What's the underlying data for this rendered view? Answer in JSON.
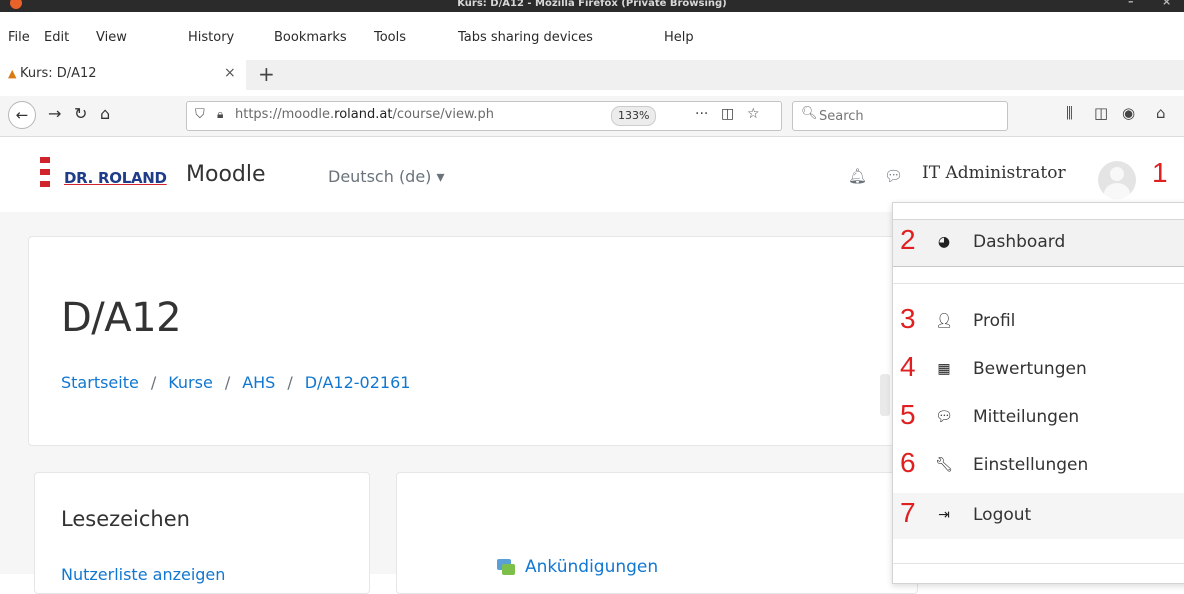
{
  "window": {
    "title": "Kurs: D/A12 - Mozilla Firefox (Private Browsing)"
  },
  "menubar": {
    "items": [
      "File",
      "Edit",
      "View",
      "History",
      "Bookmarks",
      "Tools",
      "Tabs sharing devices",
      "Help"
    ]
  },
  "tabs": [
    {
      "title": "Kurs: D/A12",
      "close": "×"
    }
  ],
  "newtab": "+",
  "navbar": {
    "url_prefix": "https://moodle.",
    "url_domain": "roland.at",
    "url_suffix": "/course/view.ph",
    "zoom": "133%",
    "more": "···",
    "search_placeholder": "Search"
  },
  "header": {
    "logo_brand": "DR. ROLAND",
    "site_name": "Moodle",
    "language": "Deutsch (de) ▾",
    "user_name": "IT Administrator"
  },
  "course": {
    "title": "D/A12",
    "breadcrumb": [
      "Startseite",
      "Kurse",
      "AHS",
      "D/A12-02161"
    ]
  },
  "sidebar": {
    "title": "Lesezeichen",
    "item": "Nutzerliste anzeigen"
  },
  "main": {
    "forum_link": "Ankündigungen"
  },
  "user_menu": {
    "items": [
      {
        "label": "Dashboard",
        "icon": "dashboard-icon",
        "number": "2"
      },
      {
        "label": "Profil",
        "icon": "user-icon",
        "number": "3"
      },
      {
        "label": "Bewertungen",
        "icon": "grades-table-icon",
        "number": "4"
      },
      {
        "label": "Mitteilungen",
        "icon": "chat-icon",
        "number": "5"
      },
      {
        "label": "Einstellungen",
        "icon": "wrench-icon",
        "number": "6"
      },
      {
        "label": "Logout",
        "icon": "sign-out-icon",
        "number": "7"
      }
    ],
    "avatar_number": "1"
  },
  "colors": {
    "link": "#1177d1",
    "annotation": "#e02020",
    "brand": "#1f3c88"
  }
}
